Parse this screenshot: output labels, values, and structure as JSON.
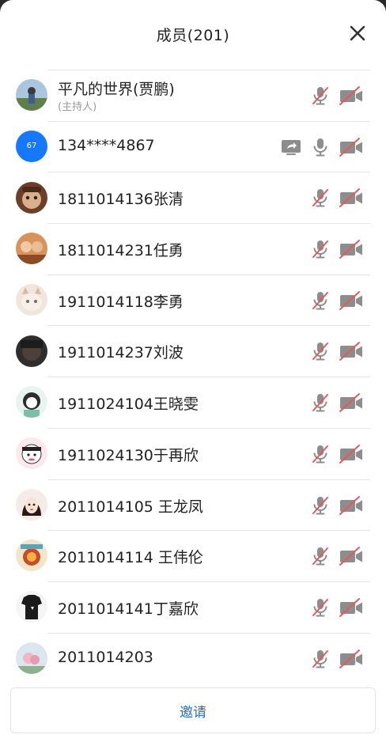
{
  "header": {
    "title": "成员(201)"
  },
  "members": [
    {
      "name": "平凡的世界(贾鹏)",
      "role": "(主持人)",
      "mic_muted": true,
      "cam_off": true,
      "avatar": "photo-landscape",
      "avatar_color": "#7fa8c9"
    },
    {
      "name": "134****4867",
      "avatar_text": "67",
      "avatar": "initials",
      "mic_muted": false,
      "cam_off": true,
      "sharing": true
    },
    {
      "name": "1811014136张清",
      "mic_muted": true,
      "cam_off": true,
      "avatar": "photo-face",
      "avatar_color": "#8a5a3c"
    },
    {
      "name": "1811014231任勇",
      "mic_muted": true,
      "cam_off": true,
      "avatar": "photo-group",
      "avatar_color": "#c0723b"
    },
    {
      "name": "1911014118李勇",
      "mic_muted": true,
      "cam_off": true,
      "avatar": "photo-cat",
      "avatar_color": "#e3d6cb"
    },
    {
      "name": "1911014237刘波",
      "mic_muted": true,
      "cam_off": true,
      "avatar": "photo-dark",
      "avatar_color": "#3b3b3b"
    },
    {
      "name": "1911024104王晓雯",
      "mic_muted": true,
      "cam_off": true,
      "avatar": "photo-cartoon",
      "avatar_color": "#b9d9cf"
    },
    {
      "name": "1911024130于再欣",
      "mic_muted": true,
      "cam_off": true,
      "avatar": "photo-anime",
      "avatar_color": "#f1d3dc"
    },
    {
      "name": "2011014105 王龙凤",
      "mic_muted": true,
      "cam_off": true,
      "avatar": "photo-girl",
      "avatar_color": "#d9c7c0"
    },
    {
      "name": "2011014114 王伟伦",
      "mic_muted": true,
      "cam_off": true,
      "avatar": "photo-art",
      "avatar_color": "#e7b86a"
    },
    {
      "name": "2011014141丁嘉欣",
      "mic_muted": true,
      "cam_off": true,
      "avatar": "photo-shirt",
      "avatar_color": "#2a2a2a"
    },
    {
      "name": "2011014203",
      "mic_muted": true,
      "cam_off": true,
      "avatar": "photo-flower",
      "avatar_color": "#c9dbe6"
    }
  ],
  "footer": {
    "invite_label": "邀请"
  },
  "colors": {
    "muted_red": "#e8585b",
    "icon_gray": "#8d8d8d",
    "accent_blue": "#1677ff",
    "link_blue": "#1f6fe0"
  },
  "icons": {
    "close": "close-icon",
    "mic_muted": "mic-muted-icon",
    "mic_on": "mic-icon",
    "camera_off": "camera-off-icon",
    "screen_share": "screen-share-icon"
  }
}
